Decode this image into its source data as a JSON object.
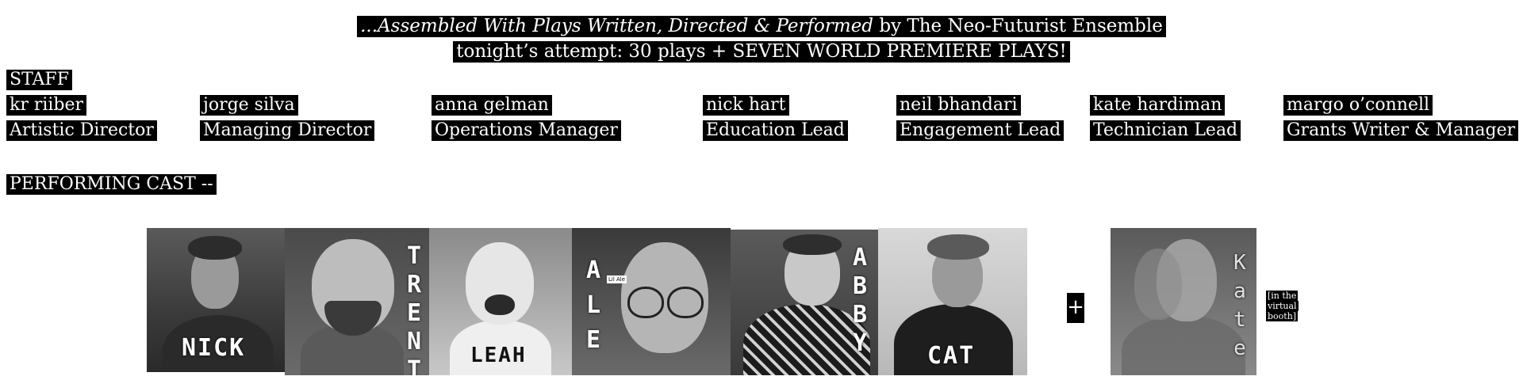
{
  "header": {
    "line1_italic": "...Assembled With Plays Written, Directed & Performed",
    "line1_rest": " by The Neo-Futurist Ensemble",
    "line2": "tonight’s attempt: 30 plays  +  SEVEN WORLD PREMIERE PLAYS!"
  },
  "staff": {
    "title": "STAFF",
    "members": [
      {
        "name": "kr  riiber",
        "role": "Artistic Director"
      },
      {
        "name": "jorge silva",
        "role": "Managing Director"
      },
      {
        "name": "anna gelman",
        "role": "Operations Manager"
      },
      {
        "name": "nick hart",
        "role": "Education Lead"
      },
      {
        "name": "neil bhandari",
        "role": "Engagement Lead"
      },
      {
        "name": "kate hardiman",
        "role": "Technician Lead"
      },
      {
        "name": "margo o’connell",
        "role": "Grants Writer & Manager"
      }
    ]
  },
  "cast": {
    "title": "PERFORMING CAST --",
    "members": [
      {
        "name": "NICK"
      },
      {
        "name": "TRENT"
      },
      {
        "name": "LEAH"
      },
      {
        "name": "ALE",
        "tag": "Lil Ale"
      },
      {
        "name": "ABBY"
      },
      {
        "name": "CAT"
      }
    ],
    "plus": "+",
    "virtual": {
      "name": "Kate",
      "note": "[in the virtual booth]"
    }
  }
}
